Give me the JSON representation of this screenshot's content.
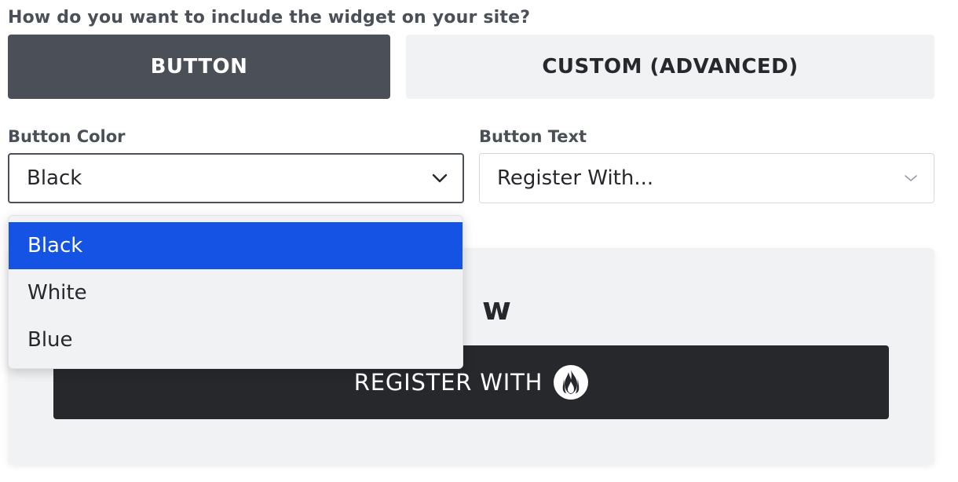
{
  "question": "How do you want to include the widget on your site?",
  "mode_tabs": [
    {
      "label": "BUTTON",
      "selected": true
    },
    {
      "label": "CUSTOM (ADVANCED)",
      "selected": false
    }
  ],
  "button_color": {
    "label": "Button Color",
    "value": "Black",
    "options": [
      "Black",
      "White",
      "Blue"
    ]
  },
  "button_text": {
    "label": "Button Text",
    "value": "Register With..."
  },
  "preview": {
    "title_fragment": "w",
    "register_button_label": "REGISTER WITH",
    "logo_icon": "flame-logo-icon"
  },
  "colors": {
    "active_tab": "#4b5058",
    "option_highlight": "#1553e4",
    "preview_button": "#26282c"
  }
}
